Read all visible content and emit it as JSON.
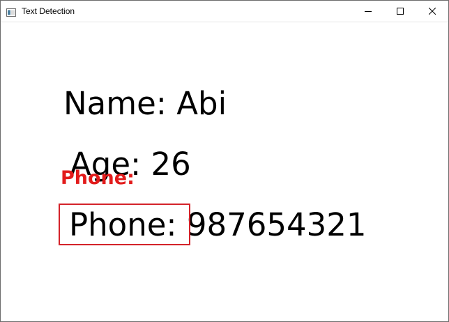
{
  "window": {
    "title": "Text Detection"
  },
  "controls": {
    "minimize_icon": "minimize-icon",
    "maximize_icon": "maximize-icon",
    "close_icon": "close-icon"
  },
  "document": {
    "name_line": "Name: Abi",
    "age_line": "Age: 26",
    "phone_line": "Phone: 987654321"
  },
  "detection": {
    "label": "Phone:",
    "color": "#e21b1b"
  }
}
